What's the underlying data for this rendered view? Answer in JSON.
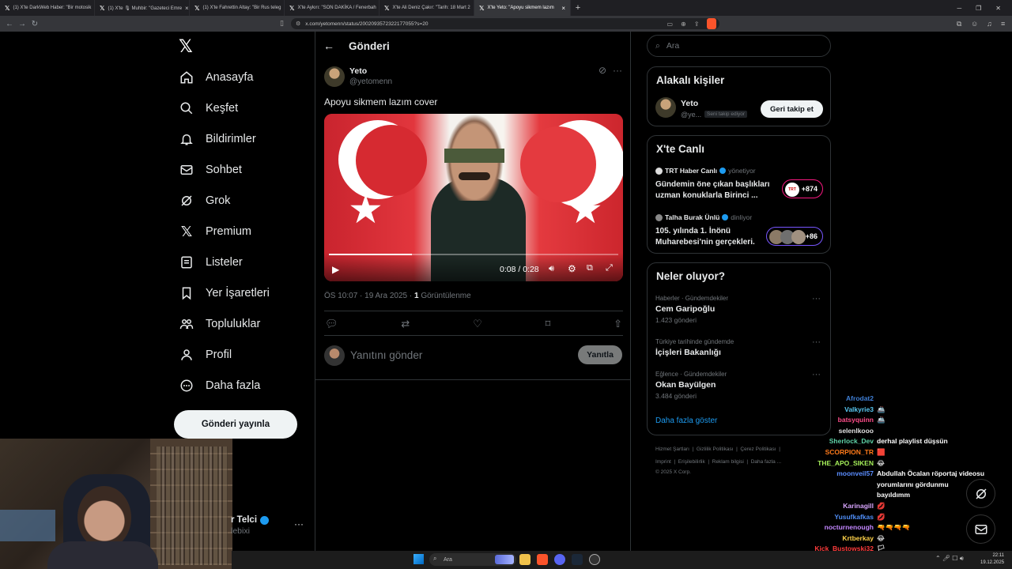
{
  "browser": {
    "tabs": [
      {
        "label": "(1) X'te DarkWeb Haber: \"Bir motosik"
      },
      {
        "label": "(1) X'te 🎙 Muhbir: \"Gazeteci Emre"
      },
      {
        "label": "(1) X'te Fahrettin Altay: \"Bir Rus teleg"
      },
      {
        "label": "X'te Aykırı: \"SON DAKİKA / Fenerbah"
      },
      {
        "label": "X'te Ali Deniz Çakır: \"Tarih: 18 Mart 2"
      },
      {
        "label": "X'te Yeto: \"Apoyu sikmem lazım"
      }
    ],
    "url": "x.com/yetomenn/status/2002093572322177055?s=20"
  },
  "sidebar": {
    "items": [
      {
        "label": "Anasayfa",
        "icon": "home-icon"
      },
      {
        "label": "Keşfet",
        "icon": "search-icon"
      },
      {
        "label": "Bildirimler",
        "icon": "bell-icon"
      },
      {
        "label": "Sohbet",
        "icon": "mail-icon"
      },
      {
        "label": "Grok",
        "icon": "grok-icon"
      },
      {
        "label": "Premium",
        "icon": "x-logo-icon"
      },
      {
        "label": "Listeler",
        "icon": "list-icon"
      },
      {
        "label": "Yer İşaretleri",
        "icon": "bookmark-icon"
      },
      {
        "label": "Topluluklar",
        "icon": "communities-icon"
      },
      {
        "label": "Profil",
        "icon": "person-icon"
      },
      {
        "label": "Daha fazla",
        "icon": "more-circle-icon"
      }
    ],
    "post_button": "Gönderi yayınla",
    "account_name": "r Telci",
    "account_handle": "lebixi"
  },
  "post": {
    "header_title": "Gönderi",
    "author_name": "Yeto",
    "author_handle": "@yetomenn",
    "text": "Apoyu sikmem lazım cover",
    "video_time": "0:08 / 0:28",
    "video_progress": 0.286,
    "time": "ÖS 10:07",
    "date": "19 Ara 2025",
    "views_count": "1",
    "views_label": "Görüntülenme",
    "reply_placeholder": "Yanıtını gönder",
    "reply_button": "Yanıtla"
  },
  "right": {
    "search_placeholder": "Ara",
    "related": {
      "title": "Alakalı kişiler",
      "name": "Yeto",
      "handle": "@ye...",
      "follows_you": "Seni takip ediyor",
      "follow_button": "Geri takip et"
    },
    "live": {
      "title": "X'te Canlı",
      "items": [
        {
          "host": "TRT Haber Canlı",
          "role": "yönetiyor",
          "title_line1": "Gündemin öne çıkan başlıkları",
          "title_line2": "uzman konuklarla Birinci ...",
          "count": "+874",
          "color": "#f91880"
        },
        {
          "host": "Talha Burak Ünlü",
          "role": "dinliyor",
          "title_line1": "105. yılında 1. İnönü",
          "title_line2": "Muharebesi'nin gerçekleri.",
          "count": "+86",
          "color": "#7856ff"
        }
      ]
    },
    "trends": {
      "title": "Neler oluyor?",
      "items": [
        {
          "meta": "Haberler · Gündemdekiler",
          "title": "Cem Garipoğlu",
          "count": "1.423 gönderi"
        },
        {
          "meta": "Türkiye tarihinde gündemde",
          "title": "İçişleri Bakanlığı",
          "count": ""
        },
        {
          "meta": "Eğlence · Gündemdekiler",
          "title": "Okan Bayülgen",
          "count": "3.484 gönderi"
        }
      ],
      "show_more": "Daha fazla göster"
    },
    "footer": {
      "line1": [
        "Hizmet Şartları",
        "Gizlilik Politikası",
        "Çerez Politikası"
      ],
      "line2": [
        "Imprint",
        "Erişilebilirlik",
        "Reklam bilgisi",
        "Daha fazla ..."
      ],
      "copyright": "© 2025 X Corp."
    }
  },
  "chat": [
    {
      "user": "Afrodat2",
      "msg": "",
      "color": "#3f7fd6"
    },
    {
      "user": "Valkyrie3",
      "msg": "🚢",
      "color": "#58c7f0"
    },
    {
      "user": "batsyquinn",
      "msg": "🚢",
      "color": "#ff4d8a"
    },
    {
      "user": "selenlkooo",
      "msg": "",
      "color": "#e0e0e0"
    },
    {
      "user": "Sherlock_Dev",
      "msg": "derhal playlist düşsün",
      "color": "#5fd3a8"
    },
    {
      "user": "SCORPION_TR",
      "msg": "🟥",
      "color": "#ff7a1a"
    },
    {
      "user": "THE_APO_SIKEN",
      "msg": "😂",
      "color": "#a6f05a"
    },
    {
      "user": "moonveil57",
      "msg": "Abdullah Öcalan röportaj videosu",
      "color": "#5b8dff"
    },
    {
      "user": "",
      "msg": "yorumlarını gördunmu",
      "color": "#fff"
    },
    {
      "user": "",
      "msg": "bayıldımm",
      "color": "#fff"
    },
    {
      "user": "Karinagill",
      "msg": "💋",
      "color": "#d9a6ff"
    },
    {
      "user": "Yusufkafkas",
      "msg": "💋",
      "color": "#4f8df5"
    },
    {
      "user": "nocturnenough",
      "msg": "🔫🔫🔫🔫",
      "color": "#c387ff"
    },
    {
      "user": "Krtberkay",
      "msg": "😂",
      "color": "#ffd24a"
    },
    {
      "user": "Kick_Bustowski32",
      "msg": "🏳",
      "color": "#ff3b3b"
    },
    {
      "user": "",
      "msg": "",
      "color": "#fff"
    },
    {
      "user": "Afrodat2",
      "msg": "",
      "color": "#3f7fd6"
    }
  ],
  "taskbar": {
    "search": "Ara",
    "time": "22:11",
    "date": "19.12.2025"
  }
}
